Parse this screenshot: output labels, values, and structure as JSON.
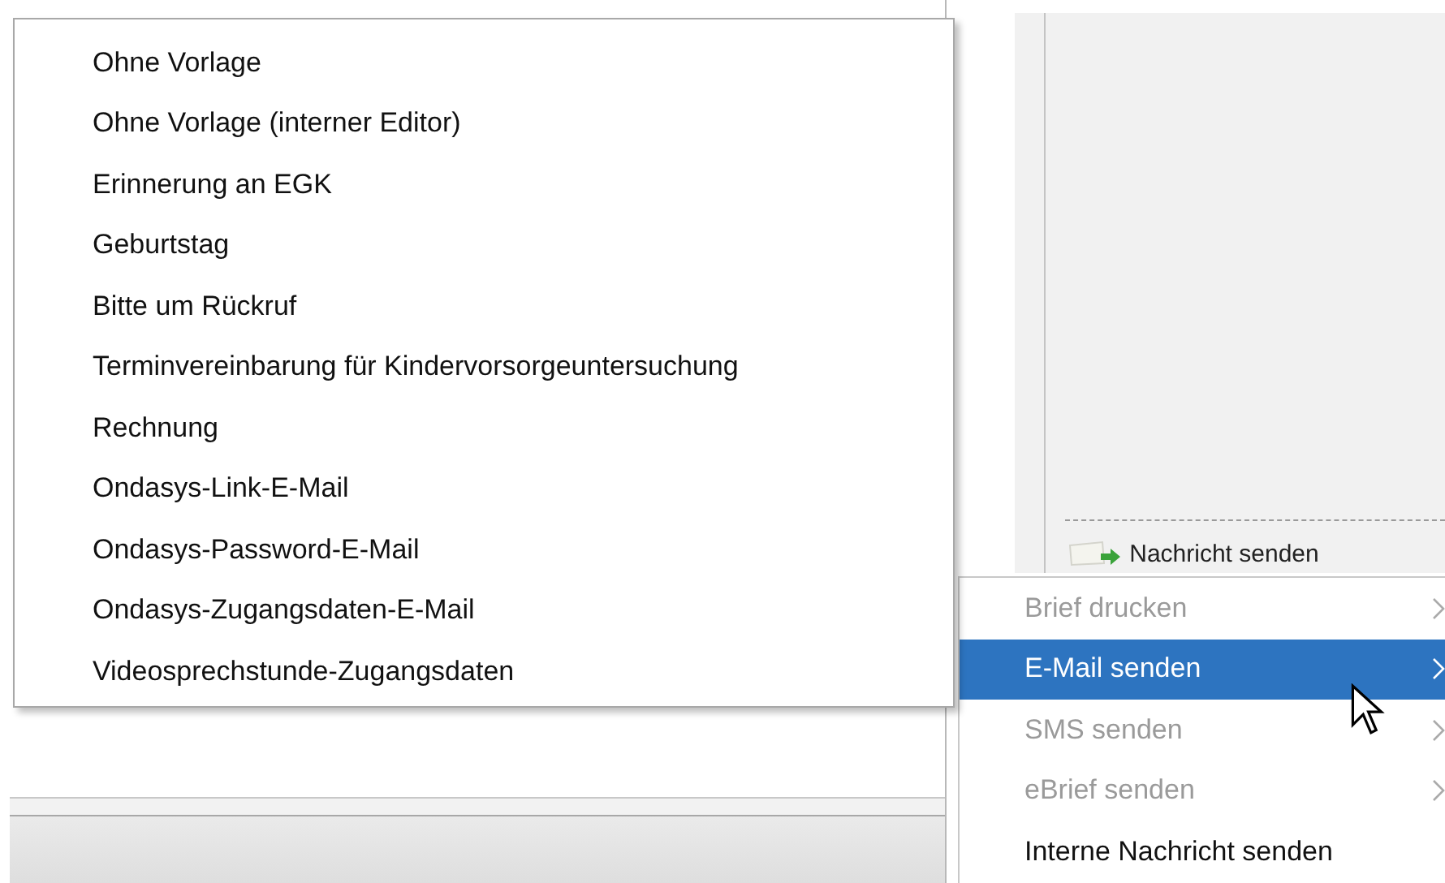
{
  "side_panel": {
    "action": "Nachricht senden"
  },
  "context_menu": {
    "items": [
      {
        "label": "Brief drucken",
        "disabled": true,
        "selected": false,
        "submenu": true
      },
      {
        "label": "E-Mail senden",
        "disabled": false,
        "selected": true,
        "submenu": true
      },
      {
        "label": "SMS senden",
        "disabled": true,
        "selected": false,
        "submenu": true
      },
      {
        "label": "eBrief senden",
        "disabled": true,
        "selected": false,
        "submenu": true
      },
      {
        "label": "Interne Nachricht senden",
        "disabled": false,
        "selected": false,
        "submenu": false
      }
    ]
  },
  "submenu": {
    "items": [
      "Ohne Vorlage",
      "Ohne Vorlage (interner Editor)",
      "Erinnerung an EGK",
      "Geburtstag",
      "Bitte um Rückruf",
      "Terminvereinbarung für Kindervorsorgeuntersuchung",
      "Rechnung",
      "Ondasys-Link-E-Mail",
      "Ondasys-Password-E-Mail",
      "Ondasys-Zugangsdaten-E-Mail",
      "Videosprechstunde-Zugangsdaten"
    ]
  }
}
